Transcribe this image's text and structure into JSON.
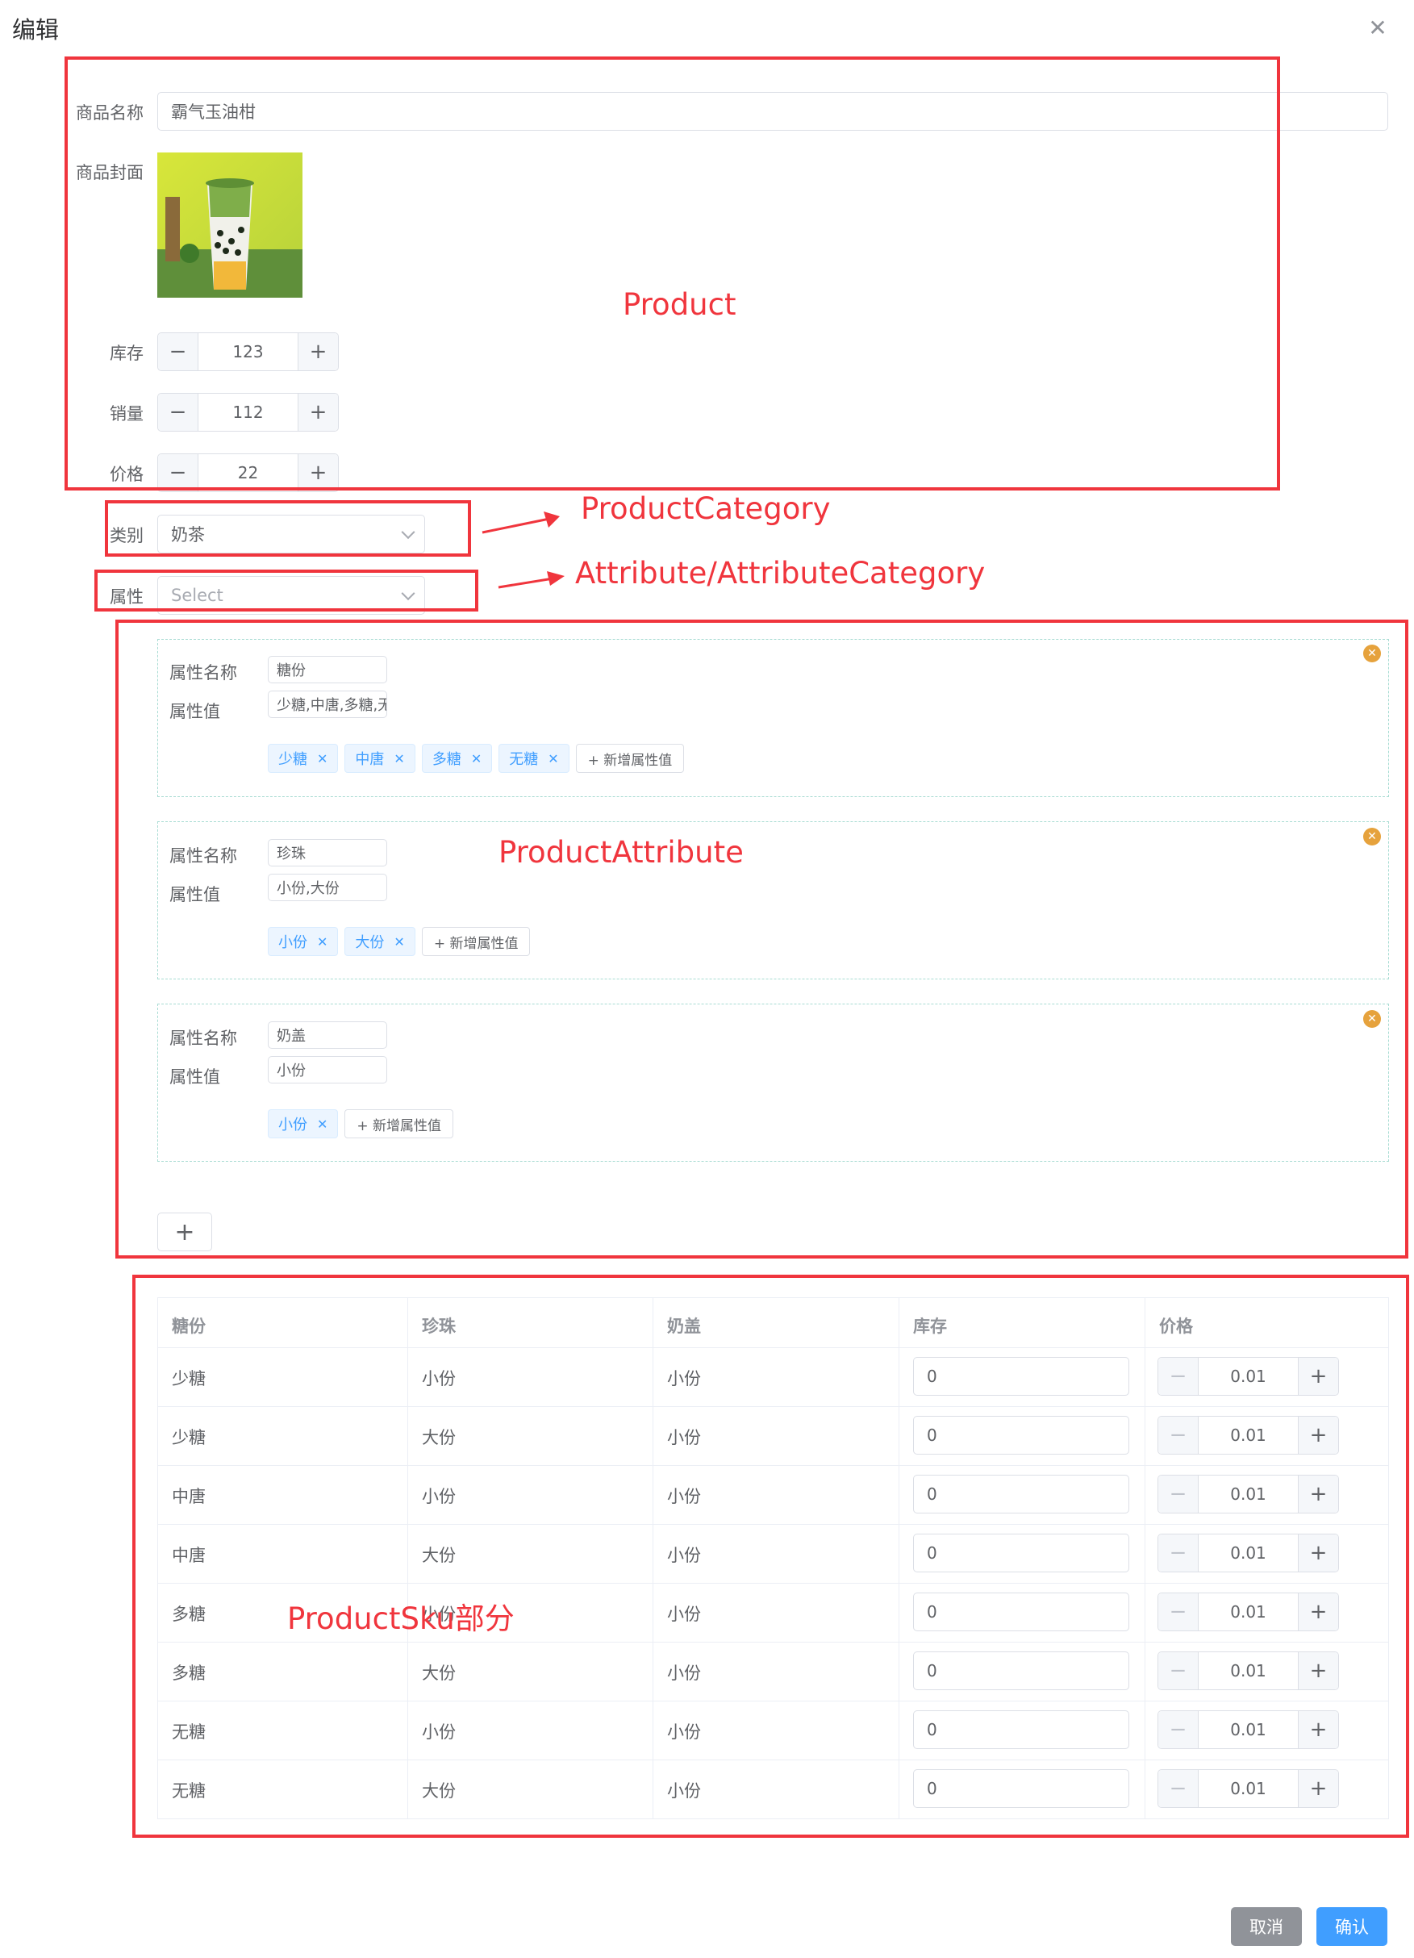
{
  "dialog": {
    "title": "编辑"
  },
  "product": {
    "name_label": "商品名称",
    "name_value": "霸气玉油柑",
    "cover_label": "商品封面",
    "stock_label": "库存",
    "stock_value": "123",
    "sales_label": "销量",
    "sales_value": "112",
    "price_label": "价格",
    "price_value": "22"
  },
  "category": {
    "label": "类别",
    "value": "奶茶"
  },
  "attribute_select": {
    "label": "属性",
    "placeholder": "Select"
  },
  "attributes": [
    {
      "name_label": "属性名称",
      "name_value": "糖份",
      "values_label": "属性值",
      "values_value": "少糖,中唐,多糖,无糖",
      "tags": [
        "少糖",
        "中唐",
        "多糖",
        "无糖"
      ],
      "add_label": "+ 新增属性值"
    },
    {
      "name_label": "属性名称",
      "name_value": "珍珠",
      "values_label": "属性值",
      "values_value": "小份,大份",
      "tags": [
        "小份",
        "大份"
      ],
      "add_label": "+ 新增属性值"
    },
    {
      "name_label": "属性名称",
      "name_value": "奶盖",
      "values_label": "属性值",
      "values_value": "小份",
      "tags": [
        "小份"
      ],
      "add_label": "+ 新增属性值"
    }
  ],
  "sku_table": {
    "headers": [
      "糖份",
      "珍珠",
      "奶盖",
      "库存",
      "价格"
    ],
    "rows": [
      {
        "c1": "少糖",
        "c2": "小份",
        "c3": "小份",
        "stock": "0",
        "price": "0.01"
      },
      {
        "c1": "少糖",
        "c2": "大份",
        "c3": "小份",
        "stock": "0",
        "price": "0.01"
      },
      {
        "c1": "中唐",
        "c2": "小份",
        "c3": "小份",
        "stock": "0",
        "price": "0.01"
      },
      {
        "c1": "中唐",
        "c2": "大份",
        "c3": "小份",
        "stock": "0",
        "price": "0.01"
      },
      {
        "c1": "多糖",
        "c2": "小份",
        "c3": "小份",
        "stock": "0",
        "price": "0.01"
      },
      {
        "c1": "多糖",
        "c2": "大份",
        "c3": "小份",
        "stock": "0",
        "price": "0.01"
      },
      {
        "c1": "无糖",
        "c2": "小份",
        "c3": "小份",
        "stock": "0",
        "price": "0.01"
      },
      {
        "c1": "无糖",
        "c2": "大份",
        "c3": "小份",
        "stock": "0",
        "price": "0.01"
      }
    ]
  },
  "footer": {
    "cancel": "取消",
    "confirm": "确认"
  },
  "annotations": {
    "product": "Product",
    "product_category": "ProductCategory",
    "attribute": "Attribute/AttributeCategory",
    "product_attribute": "ProductAttribute",
    "product_sku": "ProductSku部分"
  },
  "colors": {
    "annotation_red": "#f0353d",
    "primary": "#409eff",
    "warning": "#e6a23c",
    "cancel_gray": "#909399"
  },
  "icons": {
    "close": "close-icon",
    "chevron": "chevron-down-icon",
    "remove": "close-circle-icon",
    "add": "plus-icon"
  }
}
